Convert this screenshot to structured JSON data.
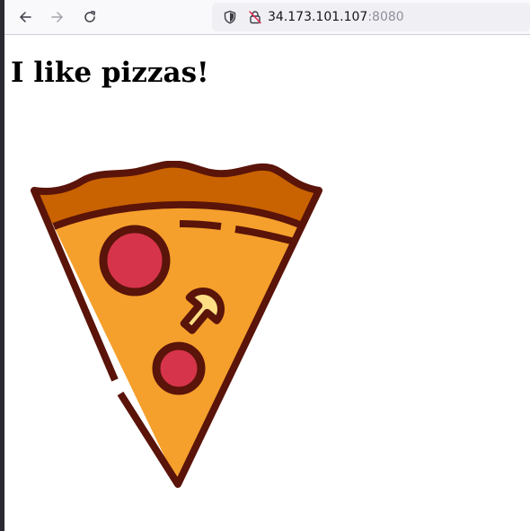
{
  "browser": {
    "url_host": "34.173.101.107",
    "url_port": ":8080",
    "icons": {
      "back": "back-arrow-icon",
      "forward": "forward-arrow-icon",
      "reload": "reload-icon",
      "tracking": "shield-icon",
      "security": "insecure-lock-icon"
    }
  },
  "page": {
    "heading": "I like pizzas!",
    "image": {
      "subject": "pizza-slice-illustration",
      "colors": {
        "outline": "#5a1409",
        "crust": "#c96200",
        "cheese": "#f5a02c",
        "pepperoni": "#d6344a",
        "mushroom": "#ffde85"
      }
    }
  }
}
